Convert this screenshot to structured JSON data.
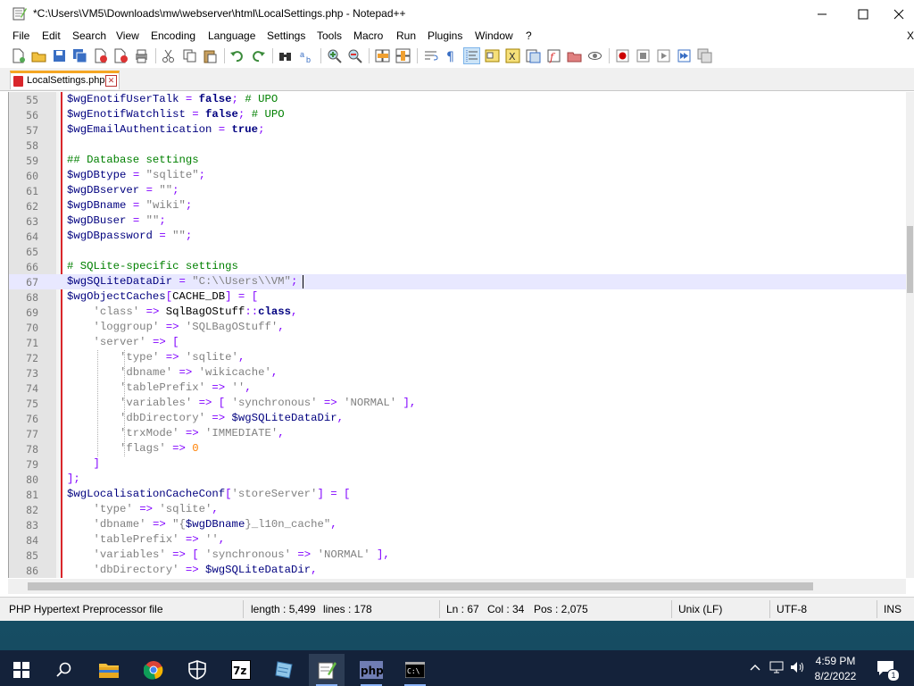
{
  "window": {
    "title": "*C:\\Users\\VM5\\Downloads\\mw\\webserver\\html\\LocalSettings.php - Notepad++"
  },
  "menu": [
    "File",
    "Edit",
    "Search",
    "View",
    "Encoding",
    "Language",
    "Settings",
    "Tools",
    "Macro",
    "Run",
    "Plugins",
    "Window",
    "?"
  ],
  "menu_close_x": "X",
  "tab": {
    "label": "LocalSettings.php"
  },
  "editor": {
    "current_line": 67,
    "lines": [
      {
        "n": "55",
        "code": "$wgEnotifUserTalk = false; # UPO"
      },
      {
        "n": "56",
        "code": "$wgEnotifWatchlist = false; # UPO"
      },
      {
        "n": "57",
        "code": "$wgEmailAuthentication = true;"
      },
      {
        "n": "58",
        "code": ""
      },
      {
        "n": "59",
        "code": "## Database settings"
      },
      {
        "n": "60",
        "code": "$wgDBtype = \"sqlite\";"
      },
      {
        "n": "61",
        "code": "$wgDBserver = \"\";"
      },
      {
        "n": "62",
        "code": "$wgDBname = \"wiki\";"
      },
      {
        "n": "63",
        "code": "$wgDBuser = \"\";"
      },
      {
        "n": "64",
        "code": "$wgDBpassword = \"\";"
      },
      {
        "n": "65",
        "code": ""
      },
      {
        "n": "66",
        "code": "# SQLite-specific settings"
      },
      {
        "n": "67",
        "code": "$wgSQLiteDataDir = \"C:\\\\Users\\\\VM\";"
      },
      {
        "n": "68",
        "code": "$wgObjectCaches[CACHE_DB] = ["
      },
      {
        "n": "69",
        "code": "    'class' => SqlBagOStuff::class,"
      },
      {
        "n": "70",
        "code": "    'loggroup' => 'SQLBagOStuff',"
      },
      {
        "n": "71",
        "code": "    'server' => ["
      },
      {
        "n": "72",
        "code": "        'type' => 'sqlite',"
      },
      {
        "n": "73",
        "code": "        'dbname' => 'wikicache',"
      },
      {
        "n": "74",
        "code": "        'tablePrefix' => '',"
      },
      {
        "n": "75",
        "code": "        'variables' => [ 'synchronous' => 'NORMAL' ],"
      },
      {
        "n": "76",
        "code": "        'dbDirectory' => $wgSQLiteDataDir,"
      },
      {
        "n": "77",
        "code": "        'trxMode' => 'IMMEDIATE',"
      },
      {
        "n": "78",
        "code": "        'flags' => 0"
      },
      {
        "n": "79",
        "code": "    ]"
      },
      {
        "n": "80",
        "code": "];"
      },
      {
        "n": "81",
        "code": "$wgLocalisationCacheConf['storeServer'] = ["
      },
      {
        "n": "82",
        "code": "    'type' => 'sqlite',"
      },
      {
        "n": "83",
        "code": "    'dbname' => \"{$wgDBname}_l10n_cache\","
      },
      {
        "n": "84",
        "code": "    'tablePrefix' => '',"
      },
      {
        "n": "85",
        "code": "    'variables' => [ 'synchronous' => 'NORMAL' ],"
      },
      {
        "n": "86",
        "code": "    'dbDirectory' => $wgSQLiteDataDir,"
      }
    ]
  },
  "status": {
    "file_type": "PHP Hypertext Preprocessor file",
    "length": "length : 5,499",
    "lines": "lines : 178",
    "ln": "Ln : 67",
    "col": "Col : 34",
    "pos": "Pos : 2,075",
    "eol": "Unix (LF)",
    "encoding": "UTF-8",
    "mode": "INS"
  },
  "clock": {
    "time": "4:59 PM",
    "date": "8/2/2022"
  },
  "notifications_count": "1",
  "colors": {
    "accent_tab": "#f5a623",
    "fold_line": "#d9262b",
    "taskbar": "#14223a"
  }
}
